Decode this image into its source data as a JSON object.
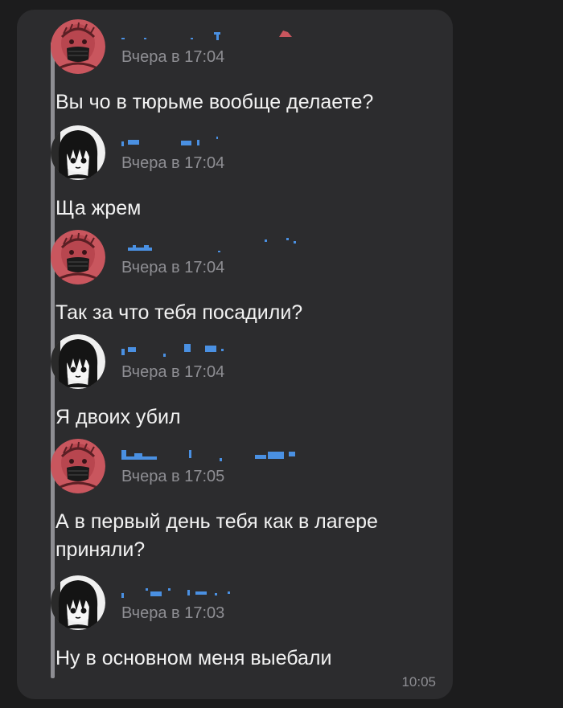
{
  "chat": {
    "messages": [
      {
        "author": "masked-user",
        "time": "Вчера в 17:04",
        "text": "Вы чо в тюрьме вообще делаете?"
      },
      {
        "author": "anime-user",
        "time": "Вчера в 17:04",
        "text": "Ща жрем"
      },
      {
        "author": "masked-user",
        "time": "Вчера в 17:04",
        "text": "Так за что тебя посадили?"
      },
      {
        "author": "anime-user",
        "time": "Вчера в 17:04",
        "text": "Я двоих убил"
      },
      {
        "author": "masked-user",
        "time": "Вчера в 17:05",
        "text": "А в первый день тебя как в лагере приняли?"
      },
      {
        "author": "anime-user",
        "time": "Вчера в 17:03",
        "text": "Ну в основном меня выебали"
      }
    ],
    "send_time": "10:05"
  },
  "colors": {
    "background": "#1c1c1d",
    "bubble": "#2c2c2e",
    "text": "#f2f2f2",
    "meta": "#8e8e93",
    "redacted_name": "#4a90e2",
    "masked_avatar": "#c9565e"
  },
  "icons": [
    "masked-avatar",
    "anime-avatar"
  ]
}
